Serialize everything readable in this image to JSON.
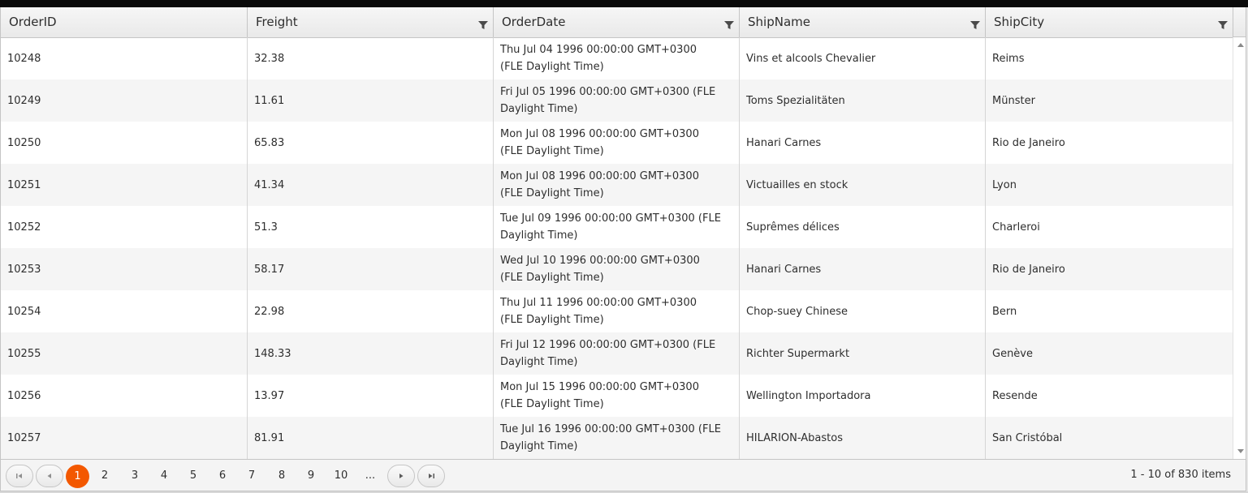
{
  "columns": [
    {
      "title": "OrderID",
      "filter": false
    },
    {
      "title": "Freight",
      "filter": true
    },
    {
      "title": "OrderDate",
      "filter": true
    },
    {
      "title": "ShipName",
      "filter": true
    },
    {
      "title": "ShipCity",
      "filter": true
    }
  ],
  "rows": [
    {
      "id": "10248",
      "freight": "32.38",
      "date": "Thu Jul 04 1996 00:00:00 GMT+0300 (FLE Daylight Time)",
      "ship": "Vins et alcools Chevalier",
      "city": "Reims"
    },
    {
      "id": "10249",
      "freight": "11.61",
      "date": "Fri Jul 05 1996 00:00:00 GMT+0300 (FLE Daylight Time)",
      "ship": "Toms Spezialitäten",
      "city": "Münster"
    },
    {
      "id": "10250",
      "freight": "65.83",
      "date": "Mon Jul 08 1996 00:00:00 GMT+0300 (FLE Daylight Time)",
      "ship": "Hanari Carnes",
      "city": "Rio de Janeiro"
    },
    {
      "id": "10251",
      "freight": "41.34",
      "date": "Mon Jul 08 1996 00:00:00 GMT+0300 (FLE Daylight Time)",
      "ship": "Victuailles en stock",
      "city": "Lyon"
    },
    {
      "id": "10252",
      "freight": "51.3",
      "date": "Tue Jul 09 1996 00:00:00 GMT+0300 (FLE Daylight Time)",
      "ship": "Suprêmes délices",
      "city": "Charleroi"
    },
    {
      "id": "10253",
      "freight": "58.17",
      "date": "Wed Jul 10 1996 00:00:00 GMT+0300 (FLE Daylight Time)",
      "ship": "Hanari Carnes",
      "city": "Rio de Janeiro"
    },
    {
      "id": "10254",
      "freight": "22.98",
      "date": "Thu Jul 11 1996 00:00:00 GMT+0300 (FLE Daylight Time)",
      "ship": "Chop-suey Chinese",
      "city": "Bern"
    },
    {
      "id": "10255",
      "freight": "148.33",
      "date": "Fri Jul 12 1996 00:00:00 GMT+0300 (FLE Daylight Time)",
      "ship": "Richter Supermarkt",
      "city": "Genève"
    },
    {
      "id": "10256",
      "freight": "13.97",
      "date": "Mon Jul 15 1996 00:00:00 GMT+0300 (FLE Daylight Time)",
      "ship": "Wellington Importadora",
      "city": "Resende"
    },
    {
      "id": "10257",
      "freight": "81.91",
      "date": "Tue Jul 16 1996 00:00:00 GMT+0300 (FLE Daylight Time)",
      "ship": "HILARION-Abastos",
      "city": "San Cristóbal"
    }
  ],
  "pager": {
    "first_icon": "first-page-icon",
    "prev_icon": "prev-page-icon",
    "next_icon": "next-page-icon",
    "last_icon": "last-page-icon",
    "pages": [
      "1",
      "2",
      "3",
      "4",
      "5",
      "6",
      "7",
      "8",
      "9",
      "10",
      "..."
    ],
    "current_page": "1",
    "info": "1 - 10 of 830 items"
  },
  "colors": {
    "accent": "#f35800",
    "header_bg": "#ededed",
    "alt_row": "#f5f5f5",
    "border": "#c5c5c5"
  }
}
